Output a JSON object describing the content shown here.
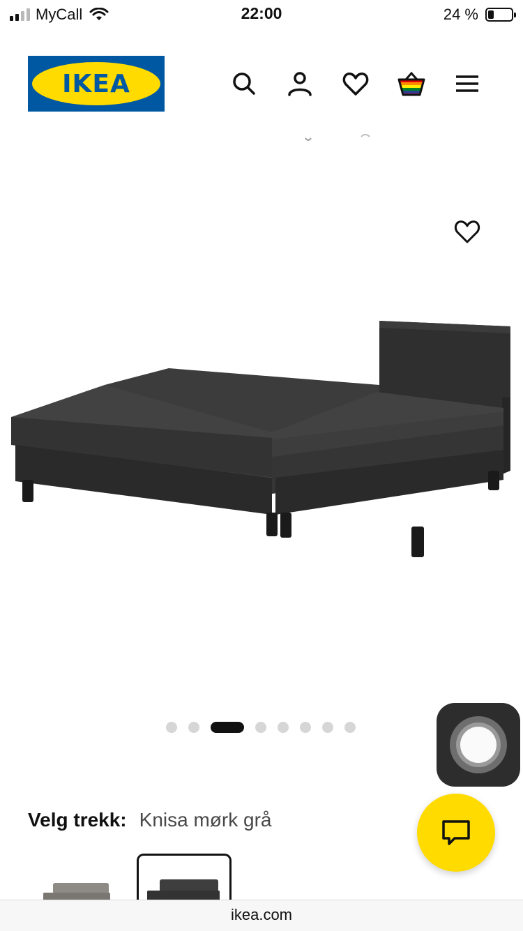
{
  "status_bar": {
    "carrier": "MyCall",
    "time": "22:00",
    "battery": "24 %",
    "battery_level": 0.24,
    "signal_bars_filled": 2
  },
  "header": {
    "logo_text": "IKEA",
    "icons": [
      "search-icon",
      "user-icon",
      "heart-icon",
      "cart-icon",
      "menu-icon"
    ]
  },
  "gallery": {
    "image_description_icon": "sofa-bed-image",
    "dot_count": 8,
    "active_dot_index": 2
  },
  "product": {
    "cover_label": "Velg trekk:",
    "cover_value": "Knisa mørk grå"
  },
  "browser": {
    "url": "ikea.com"
  },
  "colors": {
    "ikea_blue": "#0058a3",
    "ikea_yellow": "#ffdb00",
    "sofa_dark": "#3a3a3a"
  }
}
